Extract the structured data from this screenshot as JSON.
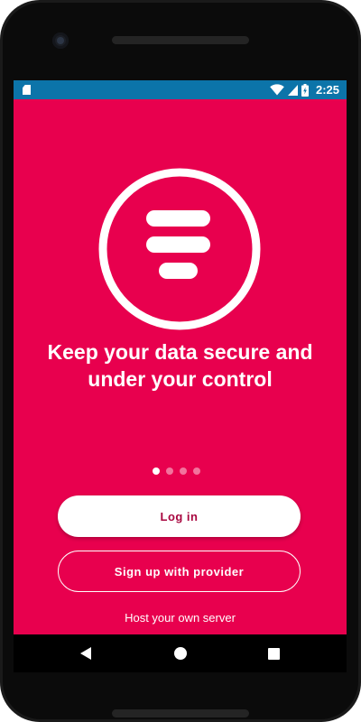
{
  "status_bar": {
    "time": "2:25",
    "icons": [
      "sd-card-icon",
      "wifi-icon",
      "signal-icon",
      "battery-charging-icon"
    ]
  },
  "onboarding": {
    "logo_icon": "app-logo-icon",
    "headline": "Keep your data secure and under your control",
    "page_count": 4,
    "active_page": 1
  },
  "actions": {
    "login_label": "Log in",
    "signup_label": "Sign up with provider",
    "host_label": "Host your own server"
  },
  "nav_bar": {
    "icons": [
      "back-icon",
      "home-icon",
      "recents-icon"
    ]
  },
  "colors": {
    "accent": "#e8004e",
    "status_bar": "#0c74a9",
    "login_text": "#a8063f"
  }
}
